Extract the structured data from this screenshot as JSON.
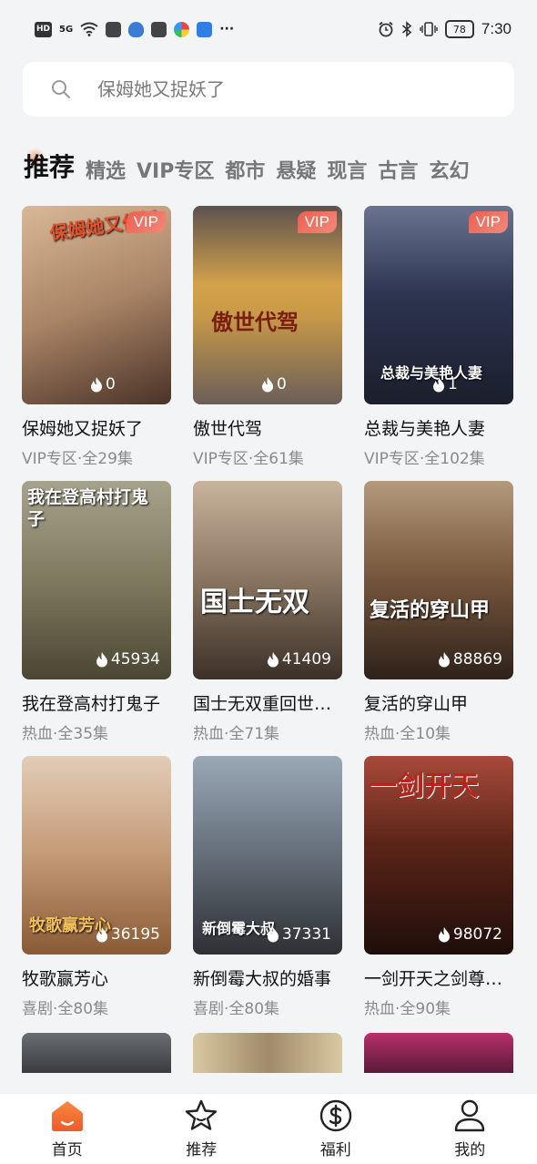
{
  "status_bar": {
    "left_badges": [
      "HD",
      "5G"
    ],
    "battery": "78",
    "time": "7:30"
  },
  "search": {
    "placeholder": "保姆她又捉妖了"
  },
  "tabs": [
    {
      "label": "推荐",
      "active": true
    },
    {
      "label": "精选"
    },
    {
      "label": "VIP专区"
    },
    {
      "label": "都市"
    },
    {
      "label": "悬疑"
    },
    {
      "label": "现言"
    },
    {
      "label": "古言"
    },
    {
      "label": "玄幻"
    }
  ],
  "cards": [
    {
      "title": "保姆她又捉妖了",
      "sub": "VIP专区·全29集",
      "heat": "0",
      "vip": "VIP",
      "poster_text": "保姆她又作妖",
      "bg": [
        "#caa584",
        "#6f4a3a"
      ]
    },
    {
      "title": "傲世代驾",
      "sub": "VIP专区·全61集",
      "heat": "0",
      "vip": "VIP",
      "poster_text": "傲世代驾",
      "bg": [
        "#d4a44f",
        "#6a5a52"
      ]
    },
    {
      "title": "总裁与美艳人妻",
      "sub": "VIP专区·全102集",
      "heat": "1",
      "vip": "VIP",
      "poster_text": "总裁与美艳人妻",
      "bg": [
        "#3c4a66",
        "#1a1f2e"
      ]
    },
    {
      "title": "我在登高村打鬼子",
      "sub": "热血·全35集",
      "heat": "45934",
      "poster_text": "我在登高村打鬼子",
      "bg": [
        "#8e8a6c",
        "#4d4a3a"
      ]
    },
    {
      "title": "国士无双重回世界之巅",
      "sub": "热血·全71集",
      "heat": "41409",
      "poster_text": "国士无双",
      "bg": [
        "#b8a48c",
        "#5d4c3e"
      ]
    },
    {
      "title": "复活的穿山甲",
      "sub": "热血·全10集",
      "heat": "88869",
      "poster_text": "复活的穿山甲",
      "bg": [
        "#8a6e50",
        "#3a2a1e"
      ]
    },
    {
      "title": "牧歌赢芳心",
      "sub": "喜剧·全80集",
      "heat": "36195",
      "poster_text": "牧歌赢芳心",
      "bg": [
        "#d6b8a0",
        "#8a5a3e"
      ]
    },
    {
      "title": "新倒霉大叔的婚事",
      "sub": "喜剧·全80集",
      "heat": "37331",
      "poster_text": "新倒霉大叔",
      "bg": [
        "#7a8a9a",
        "#3a3e44"
      ]
    },
    {
      "title": "一剑开天之剑尊归来",
      "sub": "热血·全90集",
      "heat": "98072",
      "poster_text": "一剑开天",
      "bg": [
        "#8a3a2e",
        "#2a1410"
      ]
    }
  ],
  "bottom_nav": [
    {
      "label": "首页",
      "icon": "home-icon",
      "active": true
    },
    {
      "label": "推荐",
      "icon": "star-icon"
    },
    {
      "label": "福利",
      "icon": "dollar-coin-icon"
    },
    {
      "label": "我的",
      "icon": "user-icon"
    }
  ],
  "colors": {
    "accent": "#f0632f",
    "vip_badge": "#ef5e4f",
    "background": "#f3f4f6"
  }
}
